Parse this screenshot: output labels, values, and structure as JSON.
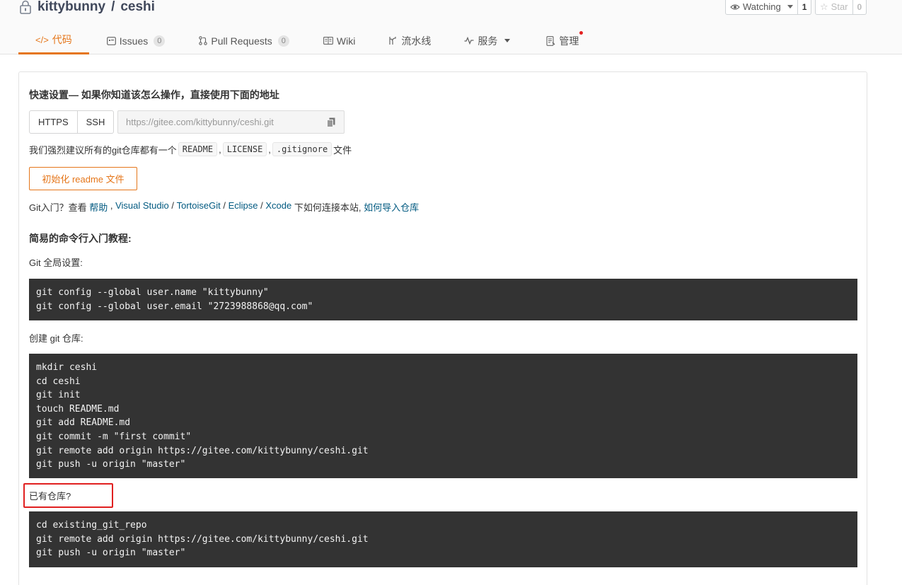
{
  "header": {
    "owner": "kittybunny",
    "separator": "/",
    "repo": "ceshi",
    "watch_label": "Watching",
    "watch_count": "1",
    "star_label": "Star",
    "star_count": "0"
  },
  "tabs": [
    {
      "label": "代码",
      "icon": "code-icon",
      "active": true
    },
    {
      "label": "Issues",
      "badge": "0",
      "icon": "issues-icon"
    },
    {
      "label": "Pull Requests",
      "badge": "0",
      "icon": "pull-request-icon"
    },
    {
      "label": "Wiki",
      "icon": "wiki-icon"
    },
    {
      "label": "流水线",
      "icon": "pipeline-icon"
    },
    {
      "label": "服务",
      "icon": "pulse-icon",
      "dropdown": true
    },
    {
      "label": "管理",
      "icon": "manage-icon",
      "notification": true
    }
  ],
  "quick": {
    "title": "快速设置— 如果你知道该怎么操作，直接使用下面的地址",
    "https_label": "HTTPS",
    "ssh_label": "SSH",
    "url": "https://gitee.com/kittybunny/ceshi.git",
    "recommend_prefix": "我们强烈建议所有的git仓库都有一个",
    "recommend_files": [
      "README",
      "LICENSE",
      ".gitignore"
    ],
    "recommend_sep": ",",
    "recommend_suffix": "文件",
    "init_button": "初始化 readme 文件"
  },
  "git_intro": {
    "prefix": "Git入门？查看 ",
    "help": "帮助",
    "sep1": " , ",
    "visual_studio": "Visual Studio",
    "sep2": " / ",
    "tortoise": "TortoiseGit",
    "sep3": " / ",
    "eclipse": "Eclipse",
    "sep4": " / ",
    "xcode": "Xcode",
    "middle": " 下如何连接本站, ",
    "import": "如何导入仓库"
  },
  "tutorial": {
    "title": "简易的命令行入门教程:",
    "global_label": "Git 全局设置:",
    "global_code": [
      "git config --global user.name \"kittybunny\"",
      "git config --global user.email \"2723988868@qq.com\""
    ],
    "create_label": "创建 git 仓库:",
    "create_code": [
      "mkdir ceshi",
      "cd ceshi",
      "git init",
      "touch README.md",
      "git add README.md",
      "git commit -m \"first commit\"",
      "git remote add origin https://gitee.com/kittybunny/ceshi.git",
      "git push -u origin \"master\""
    ],
    "existing_label": "已有仓库?",
    "existing_code": [
      "cd existing_git_repo",
      "git remote add origin https://gitee.com/kittybunny/ceshi.git",
      "git push -u origin \"master\""
    ]
  },
  "colors": {
    "accent": "#e5761a",
    "link": "#005980",
    "code_bg": "#333333",
    "highlight": "#e02020"
  }
}
